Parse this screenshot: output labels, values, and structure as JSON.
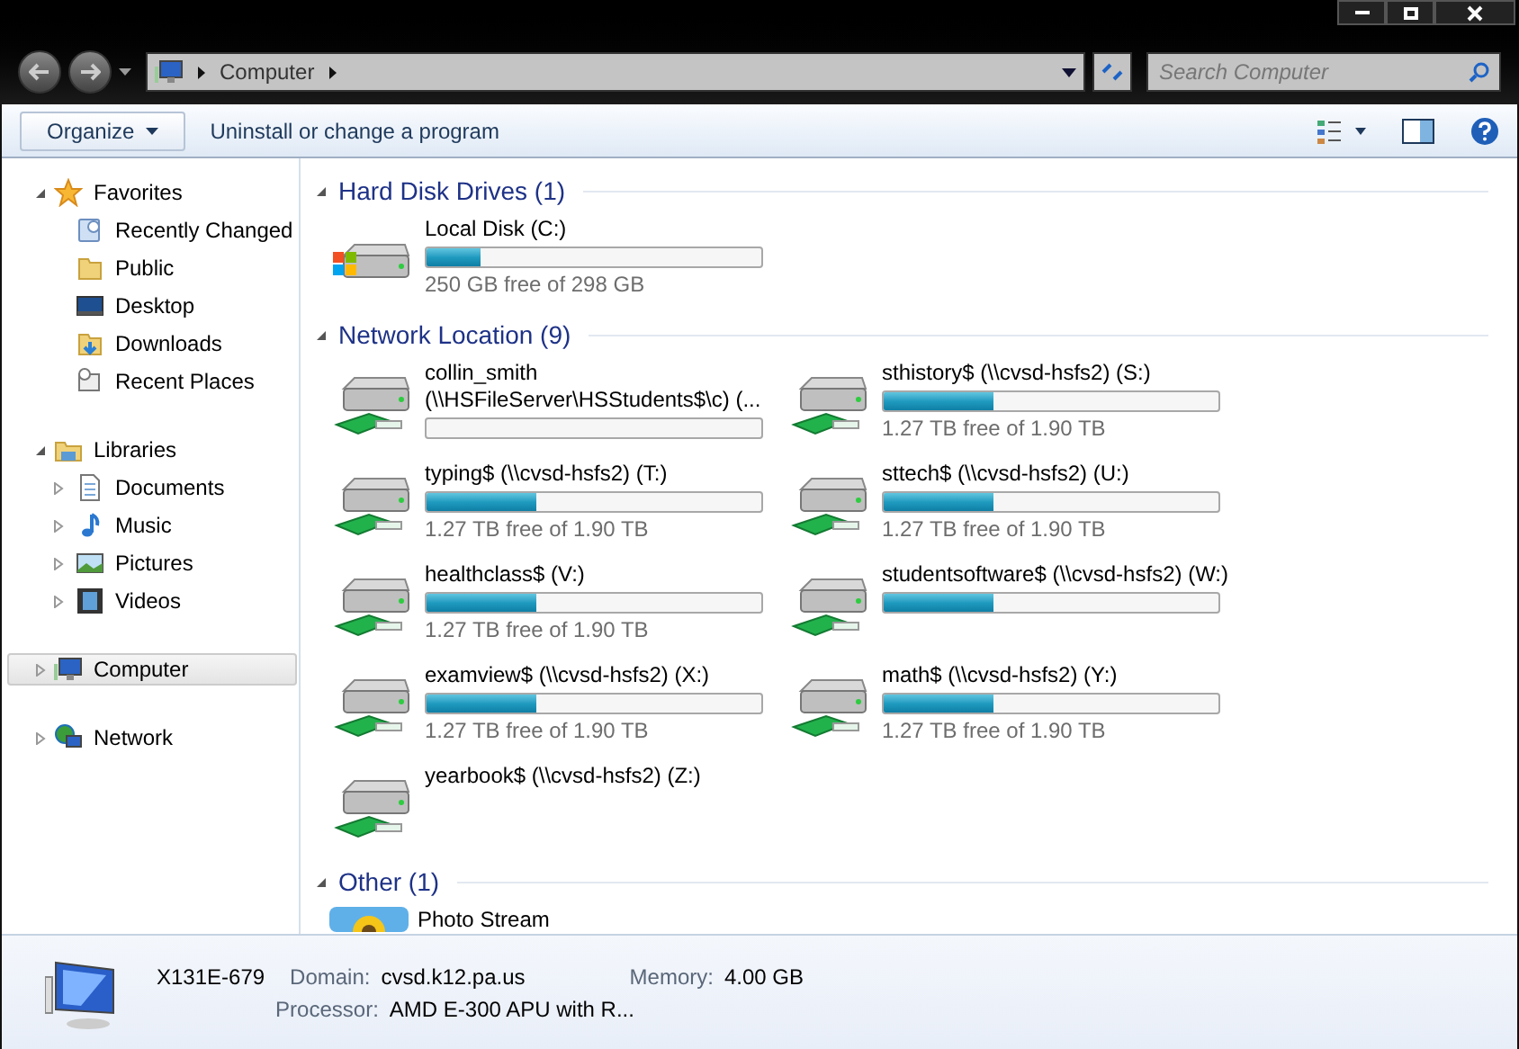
{
  "address_bar": {
    "path": [
      "Computer"
    ],
    "search_placeholder": "Search Computer"
  },
  "toolbar": {
    "buttons": [
      {
        "label": "Organize",
        "kind": "menu"
      },
      {
        "label": "Uninstall or change a program",
        "kind": "plain"
      }
    ]
  },
  "navigation": [
    {
      "label": "Favorites",
      "expanded": true,
      "selected": false,
      "children": [
        {
          "label": "Recently Changed",
          "has_children": false
        },
        {
          "label": "Public",
          "has_children": false
        },
        {
          "label": "Desktop",
          "has_children": false
        },
        {
          "label": "Downloads",
          "has_children": false
        },
        {
          "label": "Recent Places",
          "has_children": false
        }
      ]
    },
    {
      "label": "Libraries",
      "expanded": true,
      "selected": false,
      "children": [
        {
          "label": "Documents",
          "has_children": true
        },
        {
          "label": "Music",
          "has_children": true
        },
        {
          "label": "Pictures",
          "has_children": true
        },
        {
          "label": "Videos",
          "has_children": true
        }
      ]
    },
    {
      "label": "Computer",
      "expanded": false,
      "selected": true
    },
    {
      "label": "Network",
      "expanded": false,
      "selected": false
    }
  ],
  "groups": [
    {
      "title": "Hard Disk Drives (1)",
      "items": [
        {
          "name": "Local Disk (C:)",
          "kind": "local",
          "level": 0.16,
          "free": "250 GB free of 298 GB"
        }
      ]
    },
    {
      "title": "Network Location (9)",
      "items": [
        {
          "name": "collin_smith (\\\\HSFileServer\\HSStudents$\\c) (...",
          "kind": "network",
          "level": 0
        },
        {
          "name": "sthistory$ (\\\\cvsd-hsfs2) (S:)",
          "kind": "network",
          "level": 0.33,
          "free": "1.27 TB free of 1.90 TB"
        },
        {
          "name": "typing$ (\\\\cvsd-hsfs2) (T:)",
          "kind": "network",
          "level": 0.33,
          "free": "1.27 TB free of 1.90 TB"
        },
        {
          "name": "sttech$ (\\\\cvsd-hsfs2) (U:)",
          "kind": "network",
          "level": 0.33,
          "free": "1.27 TB free of 1.90 TB"
        },
        {
          "name": "healthclass$ (V:)",
          "kind": "network",
          "level": 0.33,
          "free": "1.27 TB free of 1.90 TB"
        },
        {
          "name": "studentsoftware$ (\\\\cvsd-hsfs2) (W:)",
          "kind": "network",
          "level": 0.33
        },
        {
          "name": "examview$ (\\\\cvsd-hsfs2) (X:)",
          "kind": "network",
          "level": 0.33,
          "free": "1.27 TB free of 1.90 TB"
        },
        {
          "name": "math$ (\\\\cvsd-hsfs2) (Y:)",
          "kind": "network",
          "level": 0.33,
          "free": "1.27 TB free of 1.90 TB"
        },
        {
          "name": "yearbook$ (\\\\cvsd-hsfs2) (Z:)",
          "kind": "network"
        }
      ]
    },
    {
      "title": "Other (1)",
      "items": [
        {
          "name": "Photo Stream",
          "kind": "photo"
        }
      ]
    }
  ],
  "details": {
    "computer_name": "X131E-679",
    "fields": [
      {
        "label": "Domain:",
        "value": "cvsd.k12.pa.us"
      },
      {
        "label": "Memory:",
        "value": "4.00 GB"
      },
      {
        "label": "Processor:",
        "value": "AMD E-300 APU with R..."
      }
    ]
  }
}
